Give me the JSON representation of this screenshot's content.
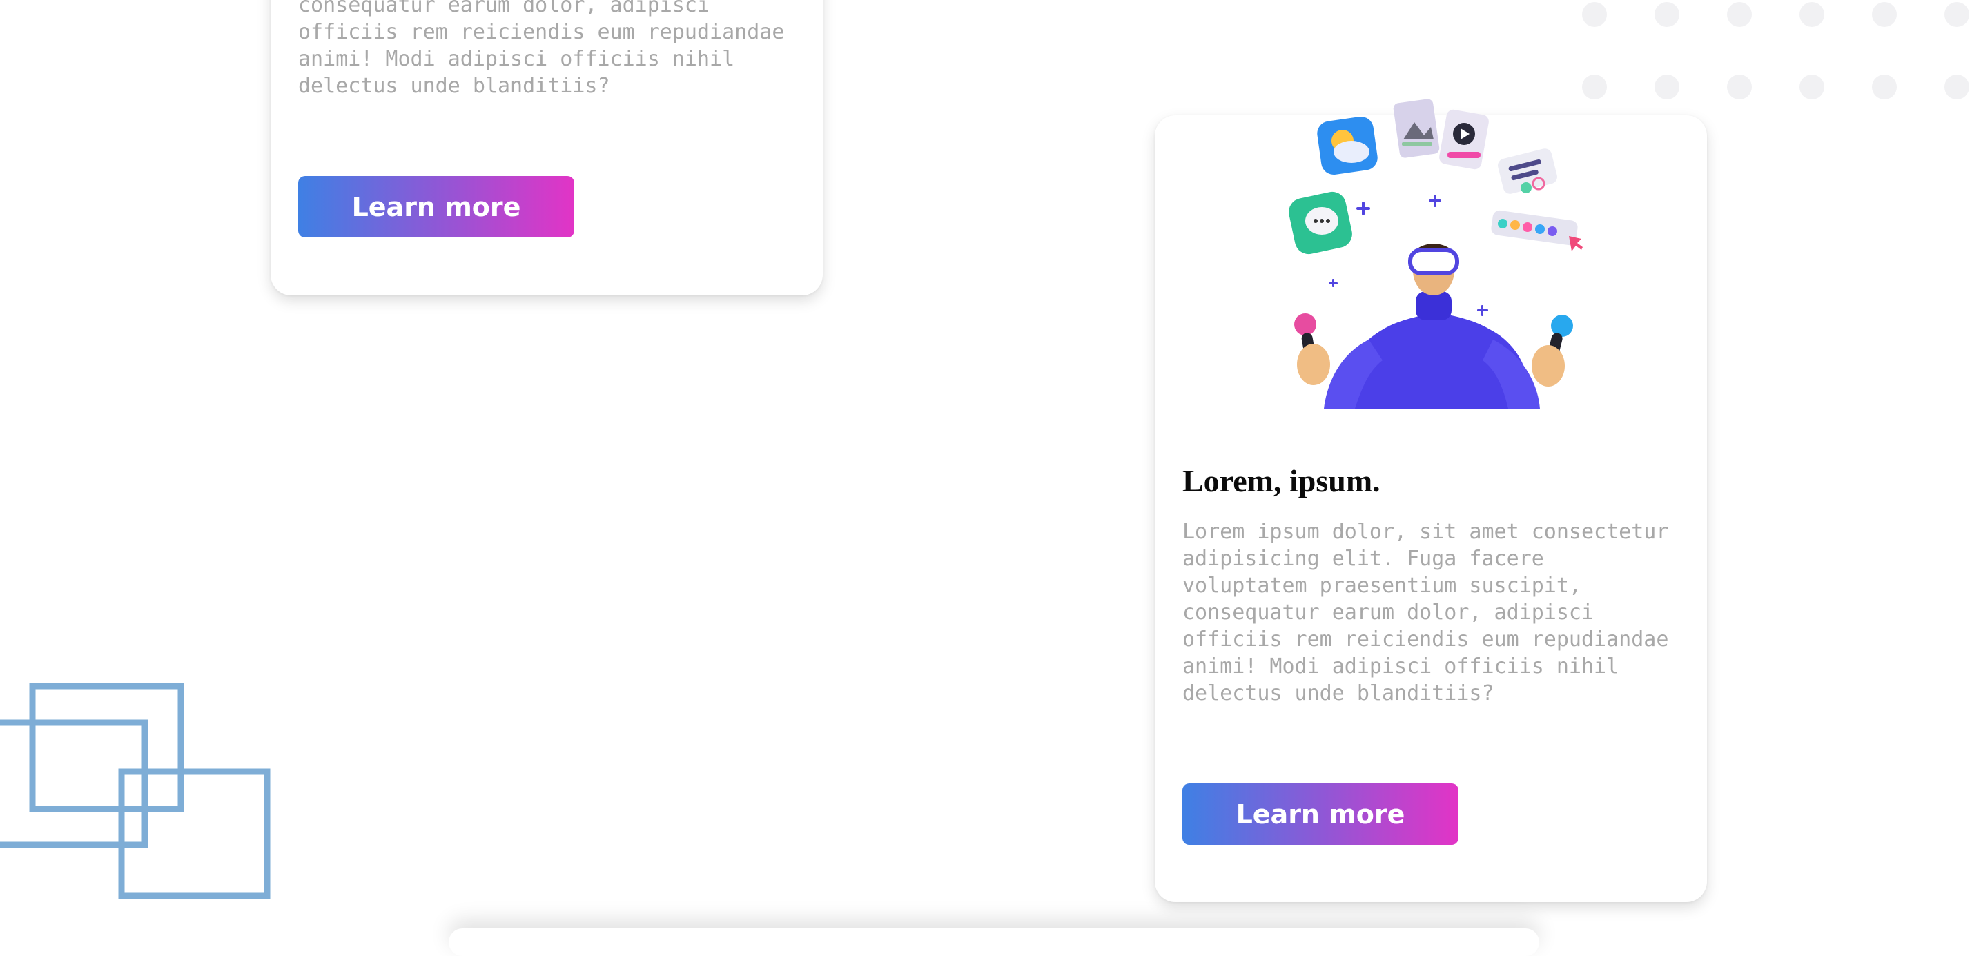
{
  "left_card": {
    "description": "consequatur earum dolor, adipisci officiis rem reiciendis eum repudiandae animi! Modi adipisci officiis nihil delectus unde blanditiis?",
    "button_label": "Learn more"
  },
  "right_card": {
    "title": "Lorem, ipsum.",
    "description": "Lorem ipsum dolor, sit amet consectetur adipisicing elit. Fuga facere voluptatem praesentium suscipit, consequatur earum dolor, adipisci officiis rem reiciendis eum repudiandae animi! Modi adipisci officiis nihil delectus unde blanditiis?",
    "button_label": "Learn more",
    "illustration_icon": "vr-person-juggling-apps-illustration"
  },
  "colors": {
    "button_gradient_start": "#3f80e4",
    "button_gradient_end": "#e234c6",
    "squares_stroke": "#7eadd6",
    "dots": "#f1f1f3",
    "illustration_body": "#4b3fe8"
  }
}
